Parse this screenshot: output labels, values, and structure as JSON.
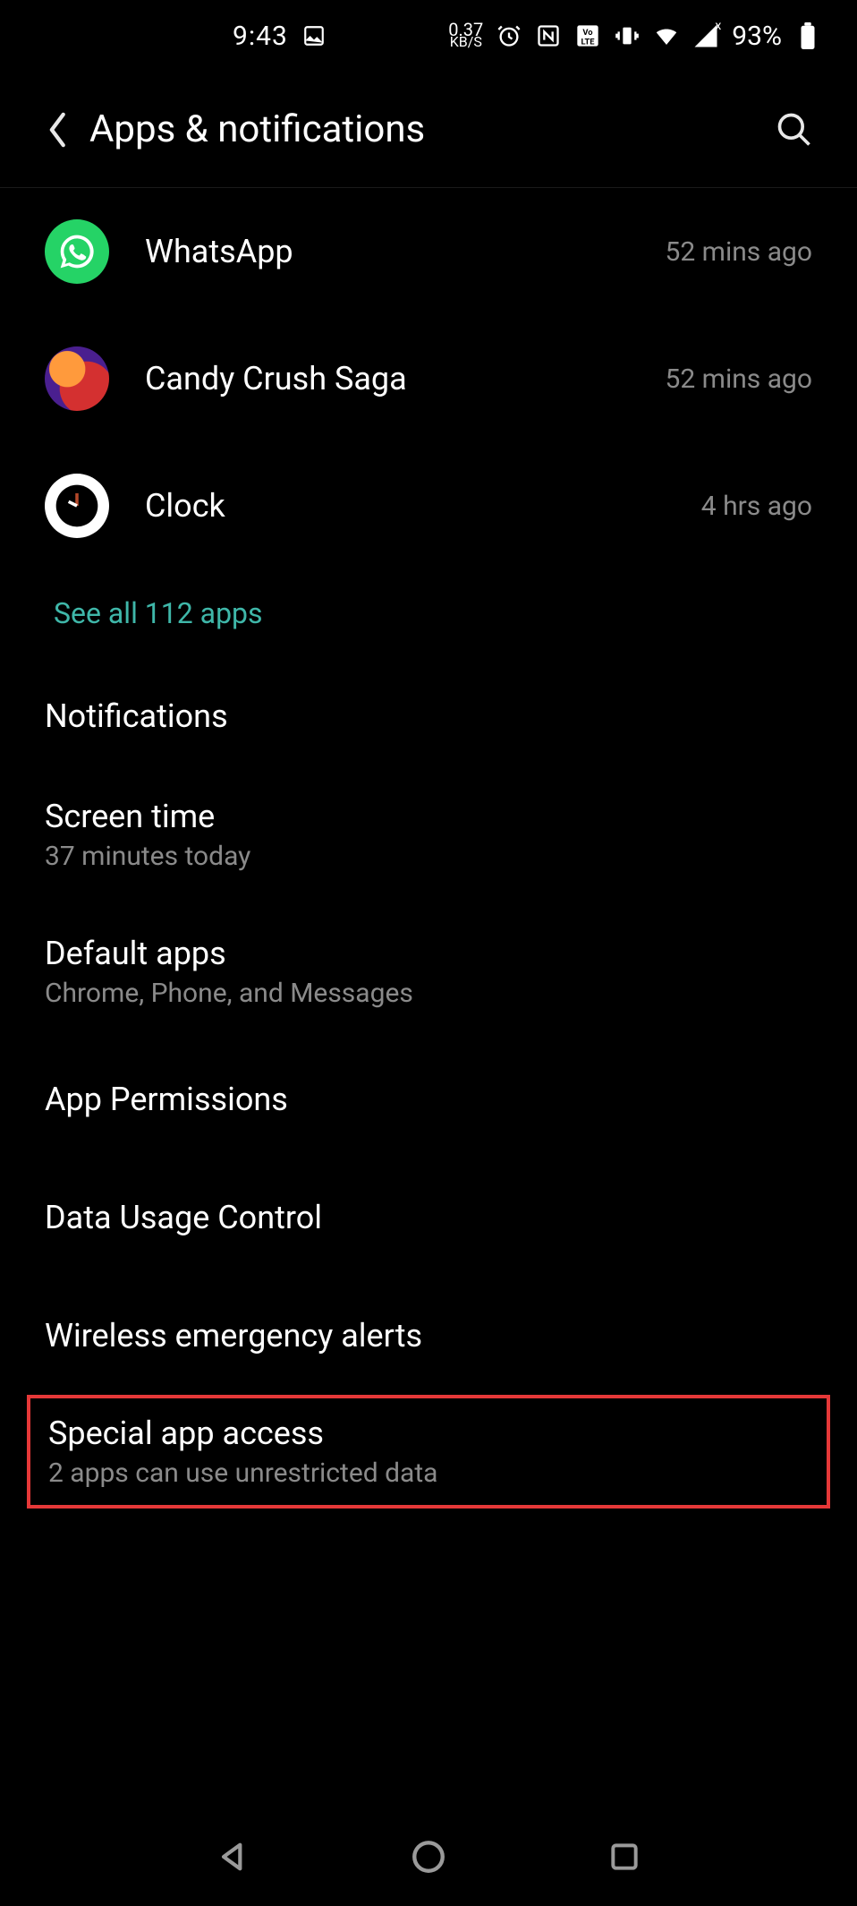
{
  "status": {
    "time": "9:43",
    "net_speed_top": "0.37",
    "net_speed_bottom": "KB/S",
    "battery_percent": "93%"
  },
  "header": {
    "title": "Apps & notifications"
  },
  "apps": [
    {
      "name": "WhatsApp",
      "time": "52 mins ago"
    },
    {
      "name": "Candy Crush Saga",
      "time": "52 mins ago"
    },
    {
      "name": "Clock",
      "time": "4 hrs ago"
    }
  ],
  "see_all": "See all 112 apps",
  "settings": {
    "notifications": "Notifications",
    "screen_time_title": "Screen time",
    "screen_time_sub": "37 minutes today",
    "default_apps_title": "Default apps",
    "default_apps_sub": "Chrome, Phone, and Messages",
    "app_permissions": "App Permissions",
    "data_usage": "Data Usage Control",
    "wireless_alerts": "Wireless emergency alerts",
    "special_access_title": "Special app access",
    "special_access_sub": "2 apps can use unrestricted data"
  }
}
